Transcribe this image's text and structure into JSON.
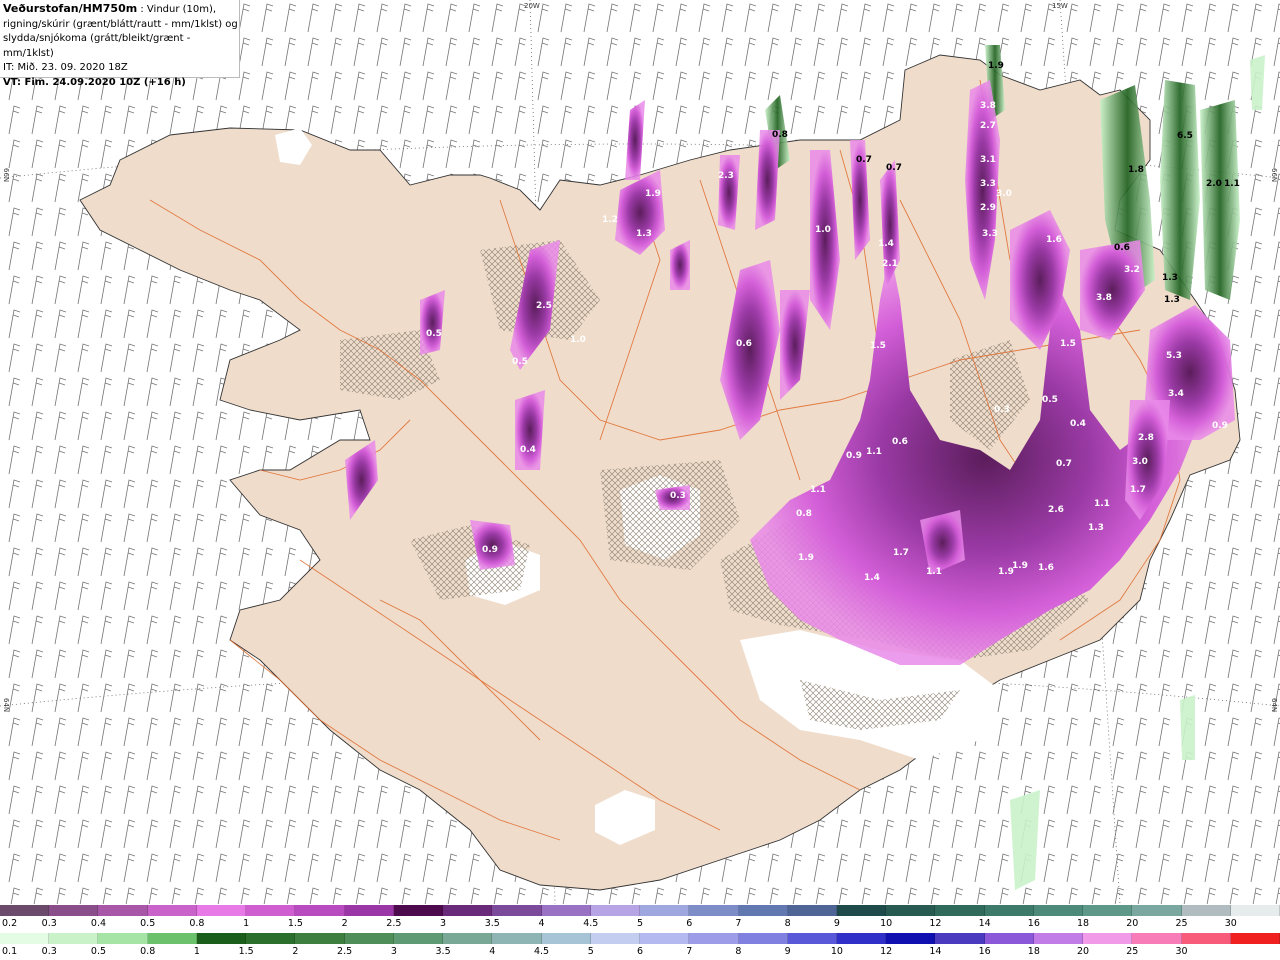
{
  "header": {
    "model": "Veðurstofan/HM750m",
    "desc_1": " : Vindur (10m),",
    "desc_2": "rigning/skúrir (grænt/blátt/rautt - mm/1klst) og",
    "desc_3": "slydda/snjókoma (grátt/bleikt/grænt - mm/1klst)",
    "issue_time": "IT: Mið. 23. 09. 2020 18Z",
    "valid_time": "VT: Fim. 24.09.2020 10Z (+16 h)"
  },
  "graticule": {
    "lon_labels": [
      "20W",
      "15W"
    ],
    "lat_labels_left": [
      "66N",
      "64N"
    ],
    "lat_labels_right": [
      "66N",
      "64N"
    ]
  },
  "precip_labels": [
    {
      "text": "1.9"
    },
    {
      "text": "3.8"
    },
    {
      "text": "2.7"
    },
    {
      "text": "3.1"
    },
    {
      "text": "3.3"
    },
    {
      "text": "3.0"
    },
    {
      "text": "2.9"
    },
    {
      "text": "3.3"
    },
    {
      "text": "6.5"
    },
    {
      "text": "1.8"
    },
    {
      "text": "2.0"
    },
    {
      "text": "1.1"
    },
    {
      "text": "0.6"
    },
    {
      "text": "3.2"
    },
    {
      "text": "1.3"
    },
    {
      "text": "3.8"
    },
    {
      "text": "1.3"
    },
    {
      "text": "0.7"
    },
    {
      "text": "0.7"
    },
    {
      "text": "0.8"
    },
    {
      "text": "1.9"
    },
    {
      "text": "1.2"
    },
    {
      "text": "1.3"
    },
    {
      "text": "1.4"
    },
    {
      "text": "2.1"
    },
    {
      "text": "1.5"
    },
    {
      "text": "0.5"
    },
    {
      "text": "1.0"
    },
    {
      "text": "2.5"
    },
    {
      "text": "1.1"
    },
    {
      "text": "0.9"
    },
    {
      "text": "1.1"
    },
    {
      "text": "0.6"
    },
    {
      "text": "0.8"
    },
    {
      "text": "1.9"
    },
    {
      "text": "1.7"
    },
    {
      "text": "1.4"
    },
    {
      "text": "1.1"
    },
    {
      "text": "1.9"
    },
    {
      "text": "1.9"
    },
    {
      "text": "1.6"
    },
    {
      "text": "2.6"
    },
    {
      "text": "1.3"
    },
    {
      "text": "1.1"
    },
    {
      "text": "1.7"
    },
    {
      "text": "3.0"
    },
    {
      "text": "2.8"
    },
    {
      "text": "3.4"
    },
    {
      "text": "5.3"
    },
    {
      "text": "1.5"
    },
    {
      "text": "0.5"
    },
    {
      "text": "0.4"
    },
    {
      "text": "0.7"
    },
    {
      "text": "0.3"
    },
    {
      "text": "0.3"
    },
    {
      "text": "0.9"
    },
    {
      "text": "0.4"
    },
    {
      "text": "0.5"
    },
    {
      "text": "0.6"
    },
    {
      "text": "1.6"
    },
    {
      "text": "2.3"
    },
    {
      "text": "0.9"
    },
    {
      "text": "1.0"
    }
  ],
  "legend_snow": {
    "colors": [
      "#6b4a6b",
      "#8a4f8a",
      "#a857a8",
      "#c962c9",
      "#e77ae7",
      "#cf5fd0",
      "#b84bbf",
      "#9a36a5",
      "#4d0a4d",
      "#6a2a7a",
      "#7c4a9a",
      "#9a72c4",
      "#b6a4e4",
      "#9fa8de",
      "#7c8dc8",
      "#6278b0",
      "#4f6596",
      "#1f4a4a",
      "#285a52",
      "#2f6a5a",
      "#3d7a6a",
      "#4d8a7a",
      "#5e9888",
      "#7aa8a0",
      "#b0bcc0",
      "#e6ecec"
    ],
    "labels": [
      "0.2",
      "0.3",
      "0.4",
      "0.5",
      "0.8",
      "1",
      "1.5",
      "2",
      "2.5",
      "3",
      "3.5",
      "4",
      "4.5",
      "5",
      "6",
      "7",
      "8",
      "9",
      "10",
      "12",
      "14",
      "16",
      "18",
      "20",
      "25",
      "30"
    ]
  },
  "legend_rain": {
    "colors": [
      "#e4fbe4",
      "#c9f2c9",
      "#a6e4a6",
      "#6cc26c",
      "#1b5e1b",
      "#2c6e2c",
      "#3e7e3e",
      "#4f8e58",
      "#5e9a74",
      "#7aa896",
      "#8fb4b4",
      "#a6c4d6",
      "#c2cdf0",
      "#b4b9f0",
      "#9c9ce8",
      "#8080e0",
      "#5858d8",
      "#3030c8",
      "#1010b0",
      "#4a3ac0",
      "#8a58d8",
      "#c27ce8",
      "#f09ae8",
      "#f87cb8",
      "#f85a7a",
      "#f02020"
    ],
    "labels": [
      "0.1",
      "0.3",
      "0.5",
      "0.8",
      "1",
      "1.5",
      "2",
      "2.5",
      "3",
      "3.5",
      "4",
      "4.5",
      "5",
      "6",
      "7",
      "8",
      "9",
      "10",
      "12",
      "14",
      "16",
      "18",
      "20",
      "25",
      "30"
    ]
  }
}
